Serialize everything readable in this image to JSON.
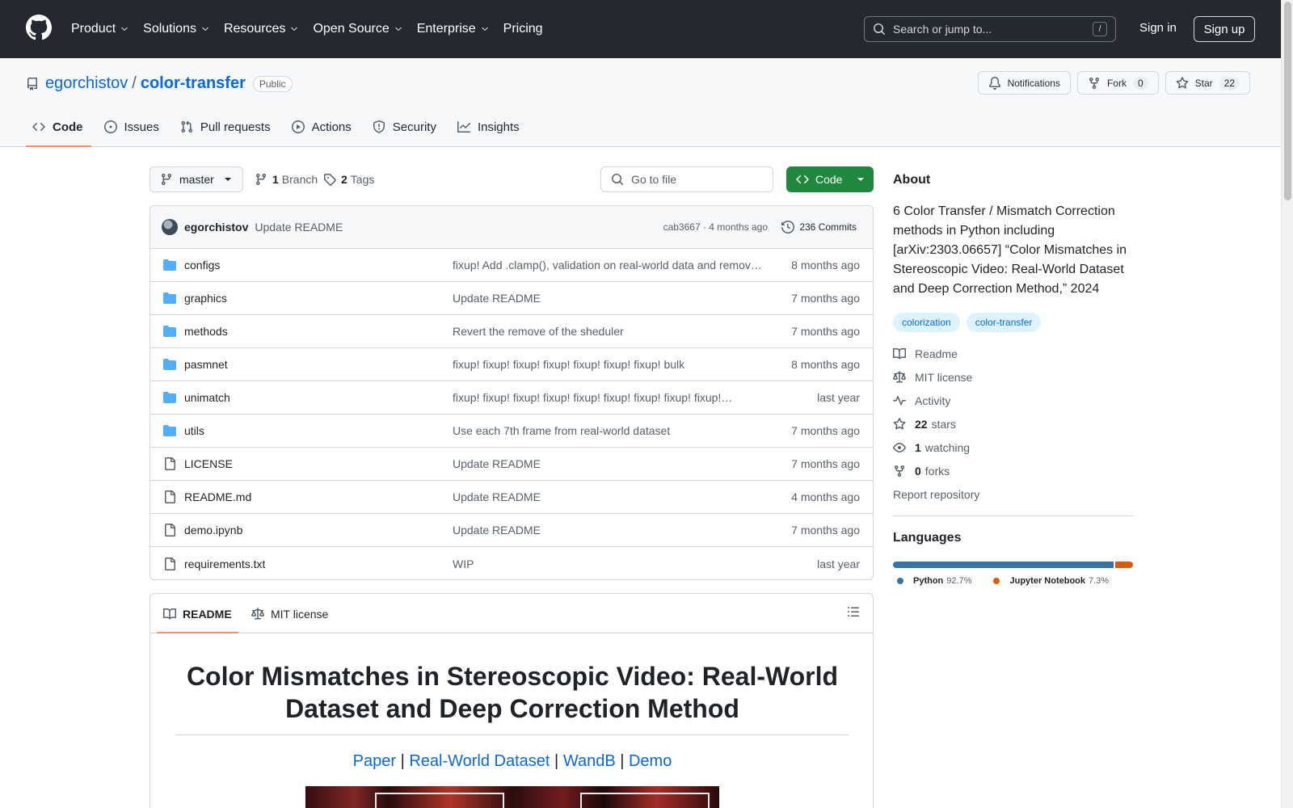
{
  "header": {
    "nav": [
      {
        "label": "Product",
        "dropdown": true
      },
      {
        "label": "Solutions",
        "dropdown": true
      },
      {
        "label": "Resources",
        "dropdown": true
      },
      {
        "label": "Open Source",
        "dropdown": true
      },
      {
        "label": "Enterprise",
        "dropdown": true
      },
      {
        "label": "Pricing",
        "dropdown": false
      }
    ],
    "search_placeholder": "Search or jump to...",
    "search_shortcut": "/",
    "signin": "Sign in",
    "signup": "Sign up"
  },
  "repo": {
    "owner": "egorchistov",
    "separator": "/",
    "name": "color-transfer",
    "visibility": "Public",
    "notifications_label": "Notifications",
    "fork_label": "Fork",
    "fork_count": "0",
    "star_label": "Star",
    "star_count": "22",
    "tabs": [
      {
        "label": "Code",
        "icon": "code-icon",
        "active": true
      },
      {
        "label": "Issues",
        "icon": "issue-icon",
        "active": false
      },
      {
        "label": "Pull requests",
        "icon": "pull-request-icon",
        "active": false
      },
      {
        "label": "Actions",
        "icon": "play-icon",
        "active": false
      },
      {
        "label": "Security",
        "icon": "shield-icon",
        "active": false
      },
      {
        "label": "Insights",
        "icon": "graph-icon",
        "active": false
      }
    ]
  },
  "filebar": {
    "branch": "master",
    "branch_count": "1",
    "branch_label": "Branch",
    "tag_count": "2",
    "tag_label": "Tags",
    "goto_placeholder": "Go to file",
    "code_label": "Code"
  },
  "latest_commit": {
    "author": "egorchistov",
    "message": "Update README",
    "meta": "cab3667 · 4 months ago",
    "commits": "236 Commits"
  },
  "files": [
    {
      "type": "dir",
      "name": "configs",
      "message": "fixup! Add .clamp(), validation on real-world data and remov…",
      "age": "8 months ago"
    },
    {
      "type": "dir",
      "name": "graphics",
      "message": "Update README",
      "age": "7 months ago"
    },
    {
      "type": "dir",
      "name": "methods",
      "message": "Revert the remove of the sheduler",
      "age": "7 months ago"
    },
    {
      "type": "dir",
      "name": "pasmnet",
      "message": "fixup! fixup! fixup! fixup! fixup! fixup! fixup! bulk",
      "age": "8 months ago"
    },
    {
      "type": "dir",
      "name": "unimatch",
      "message": "fixup! fixup! fixup! fixup! fixup! fixup! fixup! fixup! fixup!…",
      "age": "last year"
    },
    {
      "type": "dir",
      "name": "utils",
      "message": "Use each 7th frame from real-world dataset",
      "age": "7 months ago"
    },
    {
      "type": "file",
      "name": "LICENSE",
      "message": "Update README",
      "age": "7 months ago"
    },
    {
      "type": "file",
      "name": "README.md",
      "message": "Update README",
      "age": "4 months ago"
    },
    {
      "type": "file",
      "name": "demo.ipynb",
      "message": "Update README",
      "age": "7 months ago"
    },
    {
      "type": "file",
      "name": "requirements.txt",
      "message": "WIP",
      "age": "last year"
    }
  ],
  "readme": {
    "tab_readme": "README",
    "tab_license": "MIT license",
    "title": "Color Mismatches in Stereoscopic Video: Real-World Dataset and Deep Correction Method",
    "links": [
      {
        "label": "Paper"
      },
      {
        "label": "Real-World Dataset"
      },
      {
        "label": "WandB"
      },
      {
        "label": "Demo"
      }
    ],
    "link_separator": "|"
  },
  "about": {
    "title": "About",
    "description": "6 Color Transfer / Mismatch Correction methods in Python including [arXiv:2303.06657] “Color Mismatches in Stereoscopic Video: Real-World Dataset and Deep Correction Method,” 2024",
    "topics": [
      "colorization",
      "color-transfer"
    ],
    "links": [
      {
        "icon": "book-icon",
        "bold": "",
        "label": "Readme"
      },
      {
        "icon": "law-icon",
        "bold": "",
        "label": "MIT license"
      },
      {
        "icon": "pulse-icon",
        "bold": "",
        "label": "Activity"
      },
      {
        "icon": "star-icon",
        "bold": "22",
        "label": "stars"
      },
      {
        "icon": "eye-icon",
        "bold": "1",
        "label": "watching"
      },
      {
        "icon": "fork-icon",
        "bold": "0",
        "label": "forks"
      }
    ],
    "report": "Report repository"
  },
  "languages": {
    "title": "Languages",
    "items": [
      {
        "name": "Python",
        "percent": "92.7%",
        "value": 92.7,
        "color": "#3572A5"
      },
      {
        "name": "Jupyter Notebook",
        "percent": "7.3%",
        "value": 7.3,
        "color": "#DA5B0B"
      }
    ]
  }
}
